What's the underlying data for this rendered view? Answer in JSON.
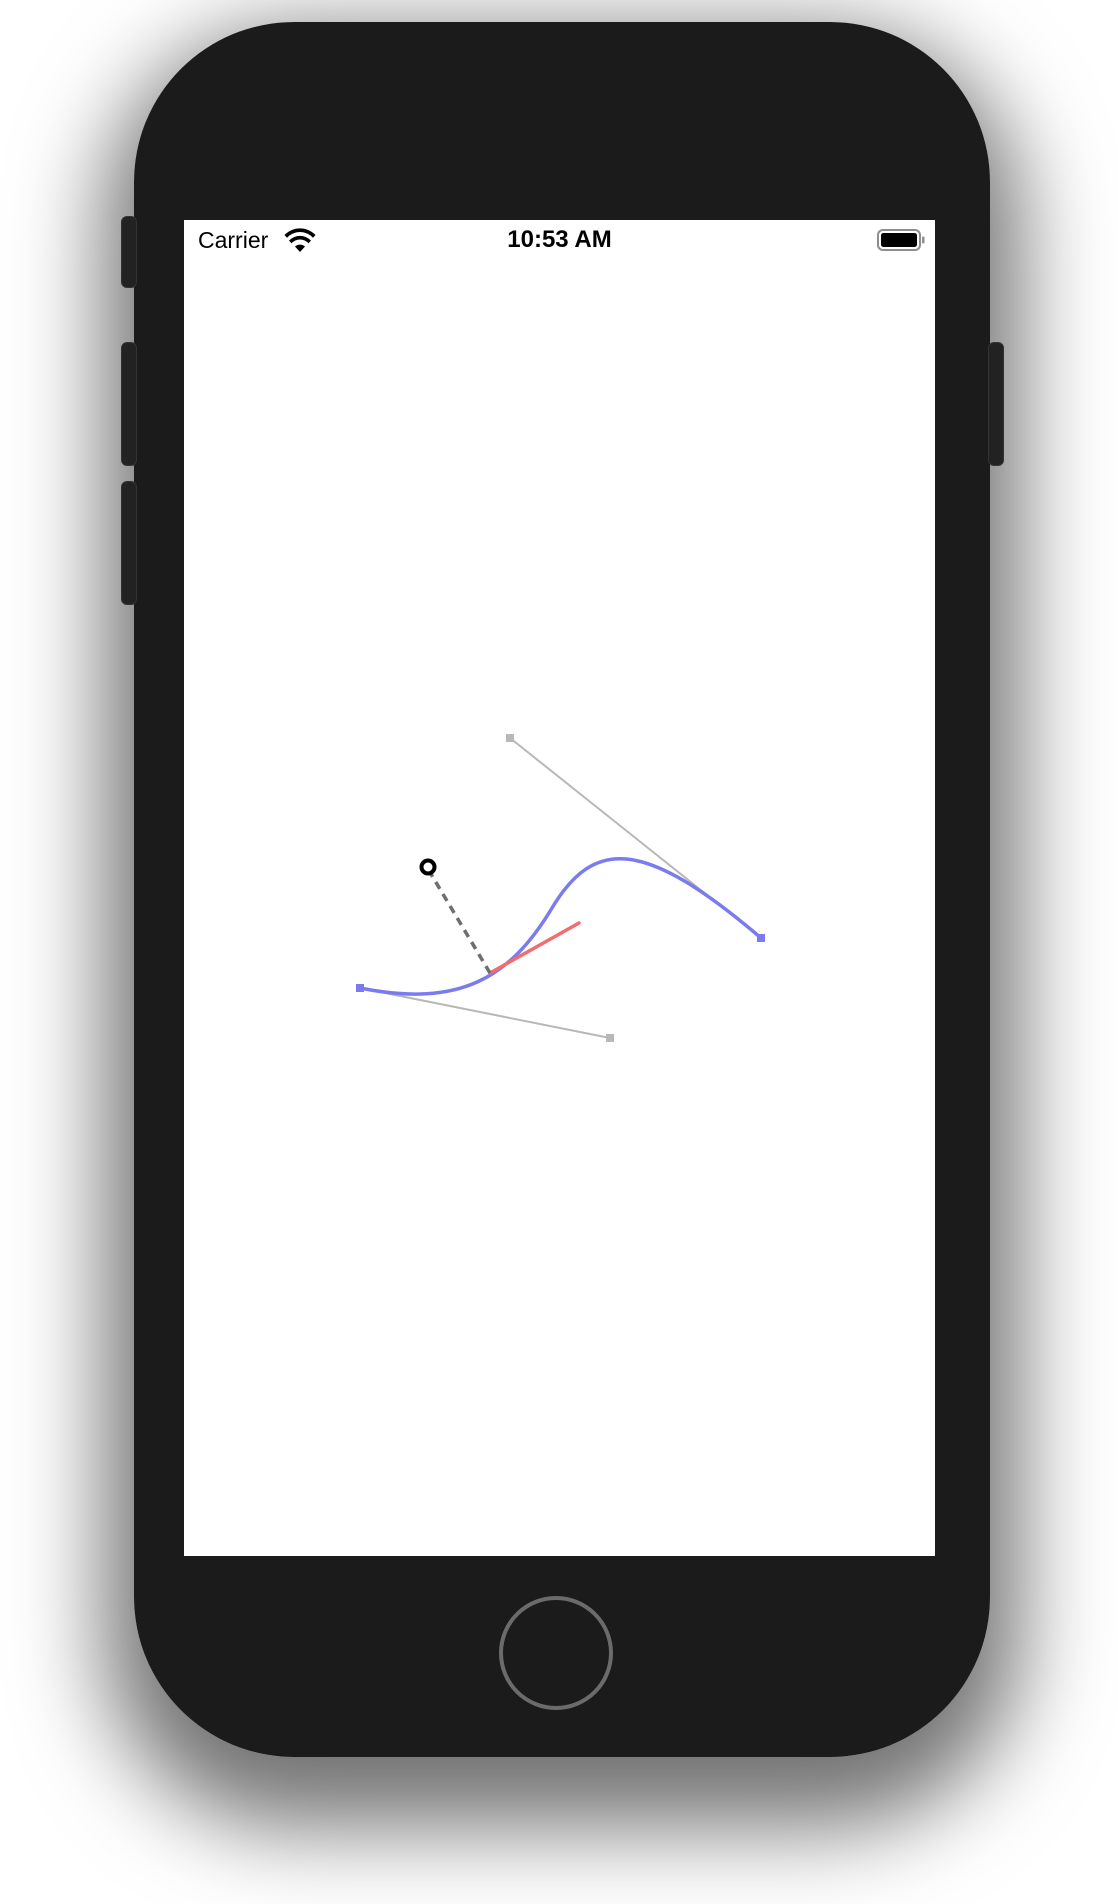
{
  "status_bar": {
    "carrier": "Carrier",
    "time": "10:53 AM",
    "wifi_icon": "wifi-icon",
    "battery_icon": "battery-icon"
  },
  "drawing": {
    "curve_color": "#7b7bf0",
    "control_line_color": "#b8b8b8",
    "tangent_color": "#f26d6d",
    "normal_color": "#6e6e6e",
    "probe_color": "#000000"
  },
  "device": {
    "home_button_icon": "home-button-icon"
  }
}
